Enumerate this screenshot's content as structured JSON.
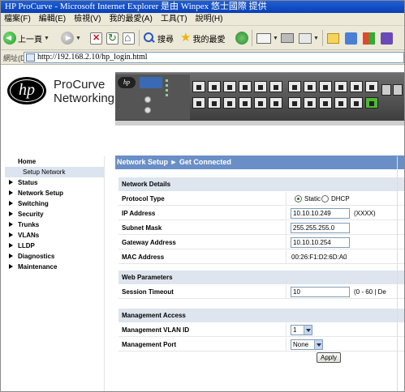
{
  "window": {
    "title": "HP ProCurve - Microsoft Internet Explorer 是由 Winpex 悠士國際 提供"
  },
  "menu": {
    "items": [
      "檔案(F)",
      "編輯(E)",
      "檢視(V)",
      "我的最愛(A)",
      "工具(T)",
      "說明(H)"
    ]
  },
  "toolbar": {
    "back_label": "上一頁",
    "search_label": "搜尋",
    "favorites_label": "我的最愛"
  },
  "address": {
    "label": "網址(D)",
    "url": "http://192.168.2.10/hp_login.html"
  },
  "brand": {
    "logo_text": "hp",
    "name_line1": "ProCurve",
    "name_line2": "Networking"
  },
  "nav": {
    "home": "Home",
    "sub_selected": "Setup Network",
    "items": [
      "Status",
      "Network Setup",
      "Switching",
      "Security",
      "Trunks",
      "VLANs",
      "LLDP",
      "Diagnostics",
      "Maintenance"
    ]
  },
  "main": {
    "title": "Network Setup ► Get Connected",
    "network_details": {
      "heading": "Network Details",
      "protocol_label": "Protocol Type",
      "protocol_options": [
        "Static",
        "DHCP"
      ],
      "protocol_selected": "Static",
      "ip_label": "IP Address",
      "ip_value": "10.10.10.249",
      "ip_hint": "(XXXX)",
      "mask_label": "Subnet Mask",
      "mask_value": "255.255.255.0",
      "gateway_label": "Gateway Address",
      "gateway_value": "10.10.10.254",
      "mac_label": "MAC Address",
      "mac_value": "00:26:F1:D2:6D:A0"
    },
    "web_parameters": {
      "heading": "Web Parameters",
      "timeout_label": "Session Timeout",
      "timeout_value": "10",
      "timeout_hint": "(0 - 60 | De"
    },
    "management_access": {
      "heading": "Management Access",
      "vlan_label": "Management VLAN ID",
      "vlan_value": "1",
      "port_label": "Management Port",
      "port_value": "None"
    },
    "apply_label": "Apply"
  }
}
